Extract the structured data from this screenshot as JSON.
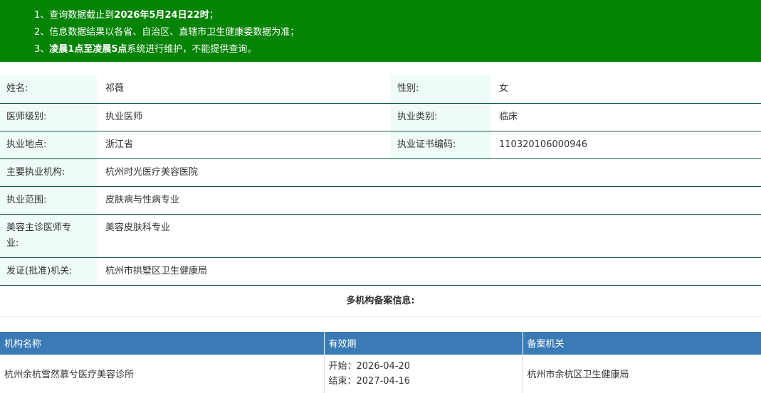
{
  "notice": {
    "line1_prefix": "1、查询数据截止到",
    "line1_bold": "2026年5月24日22时",
    "line1_suffix": "；",
    "line2": "2、信息数据结果以各省、自治区、直辖市卫生健康委数据为准；",
    "line3_prefix": "3、",
    "line3_bold": "凌晨1点至凌晨5点",
    "line3_suffix": "系统进行维护，不能提供查询。"
  },
  "info": {
    "name_label": "姓名:",
    "name_value": "祁薇",
    "gender_label": "性别:",
    "gender_value": "女",
    "level_label": "医师级别:",
    "level_value": "执业医师",
    "category_label": "执业类别:",
    "category_value": "临床",
    "location_label": "执业地点:",
    "location_value": "浙江省",
    "cert_label": "执业证书编码:",
    "cert_value": "110320106000946",
    "org_label": "主要执业机构:",
    "org_value": "杭州时光医疗美容医院",
    "scope_label": "执业范围:",
    "scope_value": "皮肤病与性病专业",
    "cosmetic_label": "美容主诊医师专业:",
    "cosmetic_value": "美容皮肤科专业",
    "issuer_label": "发证(批准)机关:",
    "issuer_value": "杭州市拱墅区卫生健康局"
  },
  "multi": {
    "title": "多机构备案信息:",
    "headers": [
      "机构名称",
      "有效期",
      "备案机关"
    ],
    "rows": [
      {
        "org": "杭州余杭雪然慕兮医疗美容诊所",
        "start_label": "开始：",
        "start": "2026-04-20",
        "end_label": "结束：",
        "end": "2027-04-16",
        "authority": "杭州市余杭区卫生健康局"
      }
    ]
  }
}
